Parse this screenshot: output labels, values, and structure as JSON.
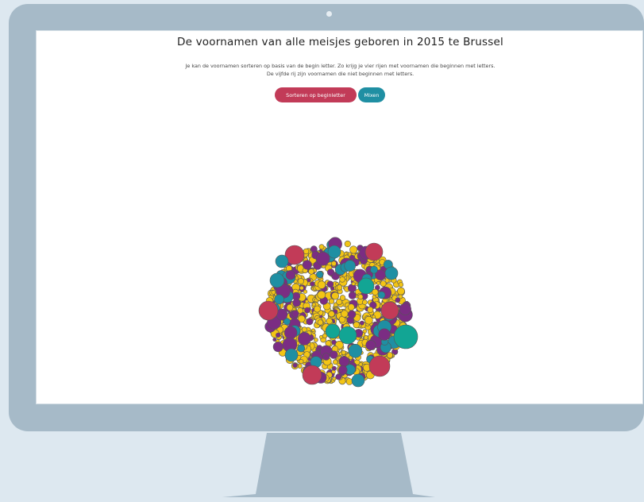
{
  "page": {
    "title": "De voornamen van alle meisjes geboren in 2015 te Brussel",
    "description_line1": "Je kan de voornamen sorteren op basis van de begin letter. Zo krijg je vier rijen met voornamen die beginnen met letters.",
    "description_line2": "De vijfde rij zijn voornamen die niet beginnen met letters.",
    "buttons": {
      "sort_label": "Sorteren op beginletter",
      "mix_label": "Mixen"
    }
  },
  "colors": {
    "monitor_frame": "#a6bac8",
    "background": "#dde8f0",
    "sort_button": "#c23b58",
    "mix_button": "#1f8fa3",
    "bubble_palette": [
      "#f3c515",
      "#7b2d83",
      "#1f8fa3",
      "#c23b58",
      "#12a594"
    ]
  }
}
